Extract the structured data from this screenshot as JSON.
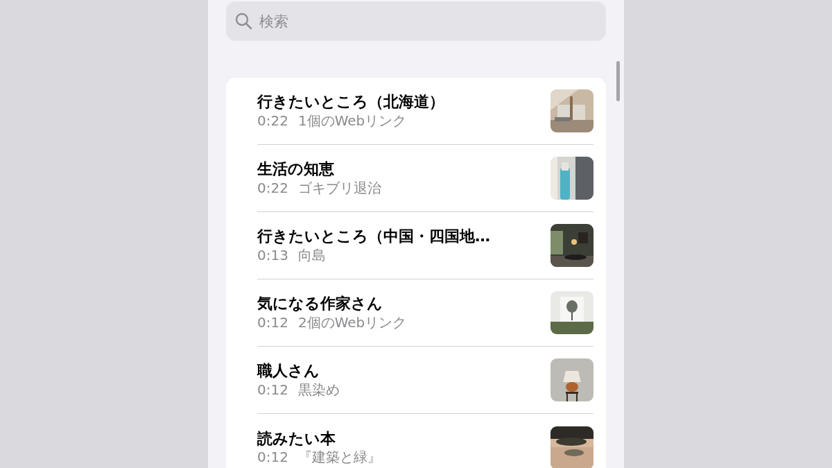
{
  "search": {
    "placeholder": "検索"
  },
  "notes": [
    {
      "title": "行きたいところ（北海道）",
      "time": "0:22",
      "preview": "1個のWebリンク"
    },
    {
      "title": "生活の知恵",
      "time": "0:22",
      "preview": "ゴキブリ退治"
    },
    {
      "title": "行きたいところ（中国・四国地…",
      "time": "0:13",
      "preview": "向島"
    },
    {
      "title": "気になる作家さん",
      "time": "0:12",
      "preview": "2個のWebリンク"
    },
    {
      "title": "職人さん",
      "time": "0:12",
      "preview": "黒染め"
    },
    {
      "title": "読みたい本",
      "time": "0:12",
      "preview": "『建築と緑』"
    }
  ]
}
